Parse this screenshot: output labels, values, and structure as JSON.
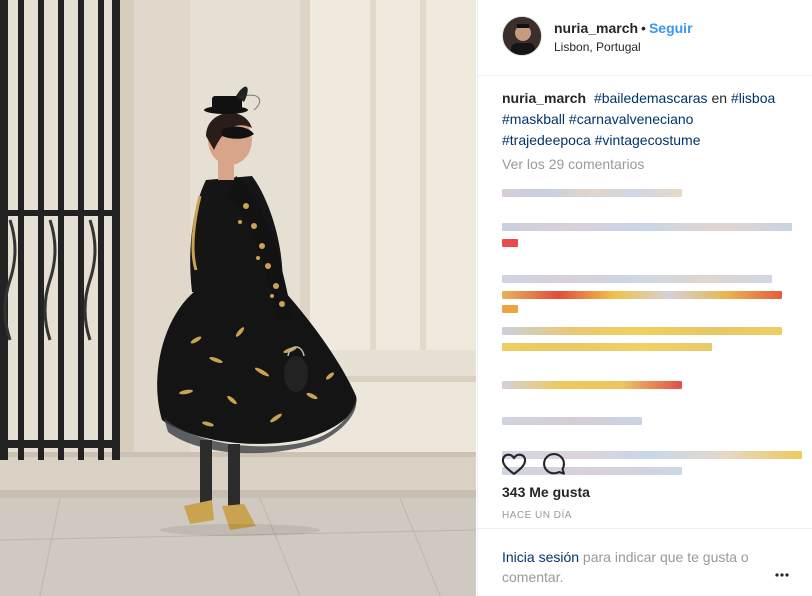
{
  "post": {
    "username": "nuria_march",
    "separator": "•",
    "follow_label": "Seguir",
    "location": "Lisbon, Portugal"
  },
  "caption": {
    "username": "nuria_march",
    "parts": {
      "tag1": "#bailedemascaras",
      "conj": " en ",
      "tag2": "#lisboa",
      "tag3": "#maskball",
      "tag4": "#carnavalveneciano",
      "tag5": "#trajedeepoca",
      "tag6": "#vintagecostume"
    }
  },
  "comments": {
    "view_all": "Ver los 29 comentarios"
  },
  "actions": {
    "like_icon": "heart-outline-icon",
    "comment_icon": "comment-bubble-icon",
    "more_icon": "more-options-icon"
  },
  "stats": {
    "likes": "343 Me gusta",
    "time": "HACE UN DÍA"
  },
  "login": {
    "link": "Inicia sesión",
    "text": " para indicar que te gusta o comentar."
  },
  "colors": {
    "link_blue": "#3897f0",
    "hashtag": "#003569",
    "muted": "#999999",
    "border": "#efefef"
  }
}
